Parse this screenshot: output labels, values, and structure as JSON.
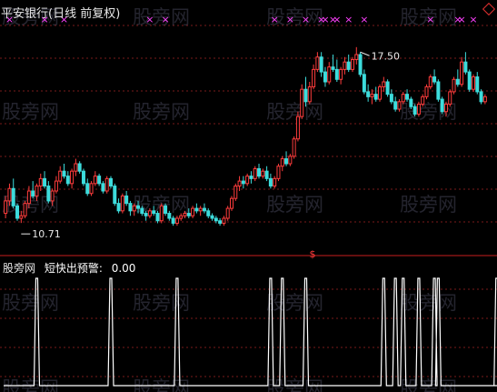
{
  "title": "平安银行(日线 前复权)",
  "sub_panel": {
    "source": "股旁网",
    "indicator": "短快出预警:",
    "value": "0.00"
  },
  "watermark": "股旁网",
  "colors": {
    "background": "#000000",
    "up": "#ff3c3c",
    "down": "#3cdcdc",
    "grid": "#7a1a1a",
    "divider": "#c81e1e",
    "signal": "#ff40ff",
    "sub_line": "#ffffff",
    "text": "#e8e8e8"
  },
  "icons": {
    "corner": "diamond-icon",
    "signal": "x-mark-icon",
    "marker": "dollar-sign-icon"
  },
  "marker_glyph": "$",
  "signal_glyph": "×",
  "chart_data": [
    {
      "type": "candlestick",
      "title": "平安银行(日线 前复权)",
      "price_range": [
        9.8,
        18.6
      ],
      "grid": true,
      "annotations": [
        {
          "label": "17.50",
          "candle_index": 91
        },
        {
          "label": "10.71",
          "candle_index": 4
        }
      ],
      "signal_marks_at_candles": [
        1,
        10,
        15,
        37,
        41,
        69,
        73,
        77,
        81,
        82,
        84,
        85,
        88,
        92,
        109,
        116,
        117,
        120,
        127,
        129,
        131
      ],
      "candles": [
        [
          11.1,
          11.8,
          10.9,
          11.6
        ],
        [
          11.6,
          12.3,
          11.4,
          12.1
        ],
        [
          12.1,
          12.5,
          11.3,
          11.4
        ],
        [
          11.4,
          11.5,
          10.8,
          10.9
        ],
        [
          10.9,
          11.2,
          10.71,
          11.0
        ],
        [
          11.0,
          11.6,
          10.9,
          11.5
        ],
        [
          11.5,
          12.2,
          11.3,
          12.0
        ],
        [
          12.0,
          12.4,
          11.7,
          11.8
        ],
        [
          11.8,
          12.3,
          11.6,
          12.2
        ],
        [
          12.2,
          12.7,
          12.0,
          12.5
        ],
        [
          12.5,
          12.8,
          12.1,
          12.2
        ],
        [
          12.2,
          12.4,
          11.5,
          11.6
        ],
        [
          11.6,
          12.1,
          11.4,
          12.0
        ],
        [
          12.0,
          12.6,
          11.9,
          12.4
        ],
        [
          12.4,
          13.0,
          12.3,
          12.8
        ],
        [
          12.8,
          13.1,
          12.5,
          12.6
        ],
        [
          12.6,
          12.8,
          12.2,
          12.3
        ],
        [
          12.3,
          12.9,
          12.1,
          12.8
        ],
        [
          12.8,
          13.3,
          12.6,
          13.1
        ],
        [
          13.1,
          13.2,
          12.7,
          12.8
        ],
        [
          12.8,
          12.9,
          12.2,
          12.3
        ],
        [
          12.3,
          12.5,
          11.8,
          11.9
        ],
        [
          11.9,
          12.4,
          11.8,
          12.3
        ],
        [
          12.3,
          12.8,
          12.2,
          12.6
        ],
        [
          12.6,
          12.7,
          12.2,
          12.3
        ],
        [
          12.3,
          12.4,
          11.9,
          12.0
        ],
        [
          12.0,
          12.6,
          11.9,
          12.5
        ],
        [
          12.5,
          12.6,
          12.1,
          12.2
        ],
        [
          12.2,
          12.3,
          11.4,
          11.5
        ],
        [
          11.5,
          11.7,
          11.1,
          11.2
        ],
        [
          11.2,
          11.9,
          11.1,
          11.8
        ],
        [
          11.8,
          12.0,
          11.4,
          11.5
        ],
        [
          11.5,
          11.6,
          11.0,
          11.2
        ],
        [
          11.2,
          11.5,
          11.0,
          11.4
        ],
        [
          11.4,
          11.6,
          11.1,
          11.3
        ],
        [
          11.3,
          11.4,
          11.0,
          11.1
        ],
        [
          11.1,
          11.2,
          10.8,
          11.0
        ],
        [
          11.0,
          11.3,
          10.9,
          11.2
        ],
        [
          11.2,
          11.4,
          11.0,
          11.1
        ],
        [
          11.1,
          11.2,
          10.7,
          10.8
        ],
        [
          10.8,
          11.5,
          10.7,
          11.4
        ],
        [
          11.4,
          11.5,
          11.0,
          11.1
        ],
        [
          11.1,
          11.2,
          10.8,
          10.9
        ],
        [
          10.9,
          11.0,
          10.6,
          10.7
        ],
        [
          10.7,
          11.0,
          10.6,
          10.9
        ],
        [
          10.9,
          11.1,
          10.8,
          11.0
        ],
        [
          11.0,
          11.2,
          10.9,
          11.1
        ],
        [
          11.1,
          11.3,
          10.9,
          11.0
        ],
        [
          11.0,
          11.4,
          10.9,
          11.3
        ],
        [
          11.3,
          11.5,
          11.1,
          11.2
        ],
        [
          11.2,
          11.4,
          11.0,
          11.3
        ],
        [
          11.3,
          11.5,
          11.1,
          11.2
        ],
        [
          11.2,
          11.3,
          10.9,
          11.0
        ],
        [
          11.0,
          11.1,
          10.8,
          10.9
        ],
        [
          10.9,
          11.0,
          10.7,
          10.8
        ],
        [
          10.8,
          10.9,
          10.6,
          10.7
        ],
        [
          10.7,
          11.0,
          10.6,
          10.9
        ],
        [
          10.9,
          11.4,
          10.8,
          11.3
        ],
        [
          11.3,
          11.8,
          11.2,
          11.7
        ],
        [
          11.7,
          12.3,
          11.6,
          12.2
        ],
        [
          12.2,
          12.6,
          12.0,
          12.4
        ],
        [
          12.4,
          12.6,
          12.1,
          12.3
        ],
        [
          12.3,
          12.7,
          12.2,
          12.6
        ],
        [
          12.6,
          12.8,
          12.3,
          12.5
        ],
        [
          12.5,
          13.0,
          12.4,
          12.9
        ],
        [
          12.9,
          13.1,
          12.5,
          12.6
        ],
        [
          12.6,
          12.9,
          12.5,
          12.8
        ],
        [
          12.8,
          13.0,
          12.4,
          12.5
        ],
        [
          12.5,
          12.7,
          12.1,
          12.2
        ],
        [
          12.2,
          12.6,
          12.1,
          12.5
        ],
        [
          12.5,
          13.1,
          12.4,
          13.0
        ],
        [
          13.0,
          13.4,
          12.8,
          13.3
        ],
        [
          13.3,
          13.6,
          13.0,
          13.1
        ],
        [
          13.1,
          13.5,
          13.0,
          13.4
        ],
        [
          13.4,
          14.2,
          13.3,
          14.1
        ],
        [
          14.1,
          15.2,
          14.0,
          15.0
        ],
        [
          15.0,
          16.3,
          14.9,
          16.1
        ],
        [
          16.1,
          16.6,
          15.4,
          15.6
        ],
        [
          15.6,
          16.4,
          15.5,
          16.2
        ],
        [
          16.2,
          17.1,
          16.1,
          16.9
        ],
        [
          16.9,
          17.6,
          16.8,
          17.4
        ],
        [
          17.4,
          17.6,
          16.6,
          16.8
        ],
        [
          16.8,
          17.0,
          16.2,
          16.4
        ],
        [
          16.4,
          17.2,
          16.3,
          17.0
        ],
        [
          17.0,
          17.5,
          16.8,
          16.9
        ],
        [
          16.9,
          17.3,
          16.4,
          16.5
        ],
        [
          16.5,
          17.0,
          16.3,
          16.9
        ],
        [
          16.9,
          17.4,
          16.7,
          17.2
        ],
        [
          17.2,
          17.5,
          16.8,
          16.9
        ],
        [
          16.9,
          17.4,
          16.8,
          17.3
        ],
        [
          17.3,
          17.8,
          17.1,
          17.5
        ],
        [
          17.5,
          17.6,
          16.6,
          16.7
        ],
        [
          16.7,
          16.9,
          15.9,
          16.0
        ],
        [
          16.0,
          16.3,
          15.6,
          15.8
        ],
        [
          15.8,
          16.1,
          15.5,
          15.9
        ],
        [
          15.9,
          16.2,
          15.6,
          15.7
        ],
        [
          15.7,
          16.3,
          15.6,
          16.2
        ],
        [
          16.2,
          16.6,
          16.0,
          16.4
        ],
        [
          16.4,
          16.5,
          15.8,
          15.9
        ],
        [
          15.9,
          16.1,
          15.5,
          15.6
        ],
        [
          15.6,
          15.8,
          15.2,
          15.3
        ],
        [
          15.3,
          15.7,
          15.2,
          15.6
        ],
        [
          15.6,
          16.0,
          15.5,
          15.9
        ],
        [
          15.9,
          16.1,
          15.6,
          15.7
        ],
        [
          15.7,
          15.8,
          15.3,
          15.4
        ],
        [
          15.4,
          15.5,
          15.0,
          15.1
        ],
        [
          15.1,
          15.6,
          15.0,
          15.5
        ],
        [
          15.5,
          15.9,
          15.4,
          15.8
        ],
        [
          15.8,
          16.3,
          15.7,
          16.2
        ],
        [
          16.2,
          16.7,
          16.1,
          16.6
        ],
        [
          16.6,
          16.9,
          16.3,
          16.4
        ],
        [
          16.4,
          16.5,
          15.6,
          15.7
        ],
        [
          15.7,
          15.8,
          15.1,
          15.2
        ],
        [
          15.2,
          15.6,
          15.0,
          15.5
        ],
        [
          15.5,
          16.1,
          15.4,
          16.0
        ],
        [
          16.0,
          16.6,
          15.9,
          16.5
        ],
        [
          16.5,
          16.9,
          16.2,
          16.3
        ],
        [
          16.3,
          17.4,
          16.2,
          17.2
        ],
        [
          17.2,
          17.6,
          16.7,
          16.8
        ],
        [
          16.8,
          16.9,
          16.0,
          16.1
        ],
        [
          16.1,
          16.7,
          16.0,
          16.6
        ],
        [
          16.6,
          16.8,
          15.9,
          16.0
        ],
        [
          16.0,
          16.1,
          15.5,
          15.6
        ],
        [
          15.6,
          15.9,
          15.5,
          15.8
        ]
      ]
    },
    {
      "type": "line",
      "title": "短快出预警:",
      "series": [
        {
          "name": "短快出预警:",
          "pulse_range": [
            0,
            1
          ],
          "pulses_at": [
            8,
            27,
            44,
            68,
            71,
            77,
            97,
            100,
            102,
            106,
            110,
            111,
            126,
            135
          ]
        }
      ],
      "last_value": 0.0
    }
  ]
}
